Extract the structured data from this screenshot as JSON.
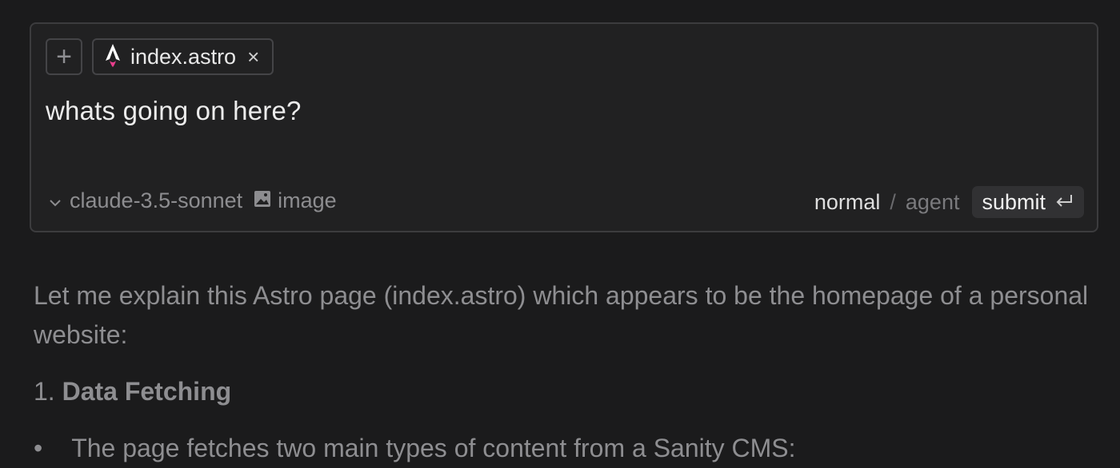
{
  "composer": {
    "add_symbol": "+",
    "file_chip": {
      "name": "index.astro",
      "close_symbol": "×",
      "icon": "astro-logo-icon"
    },
    "prompt_text": "whats going on here?",
    "model": {
      "chevron": "⌵",
      "label": "claude-3.5-sonnet"
    },
    "image_option": {
      "label": "image",
      "icon": "image-icon"
    },
    "modes": {
      "normal": "normal",
      "separator": "/",
      "agent": "agent"
    },
    "submit": {
      "label": "submit",
      "icon": "enter-icon"
    }
  },
  "response": {
    "intro": "Let me explain this Astro page (index.astro) which appears to be the homepage of a personal website:",
    "heading_number": "1.",
    "heading_text": "Data Fetching",
    "bullet_symbol": "•",
    "bullet_text": "The page fetches two main types of content from a Sanity CMS:"
  },
  "colors": {
    "background": "#1b1b1c",
    "composer_bg": "#212122",
    "border": "#3c3c3e",
    "astro_pink": "#e83e8c"
  }
}
